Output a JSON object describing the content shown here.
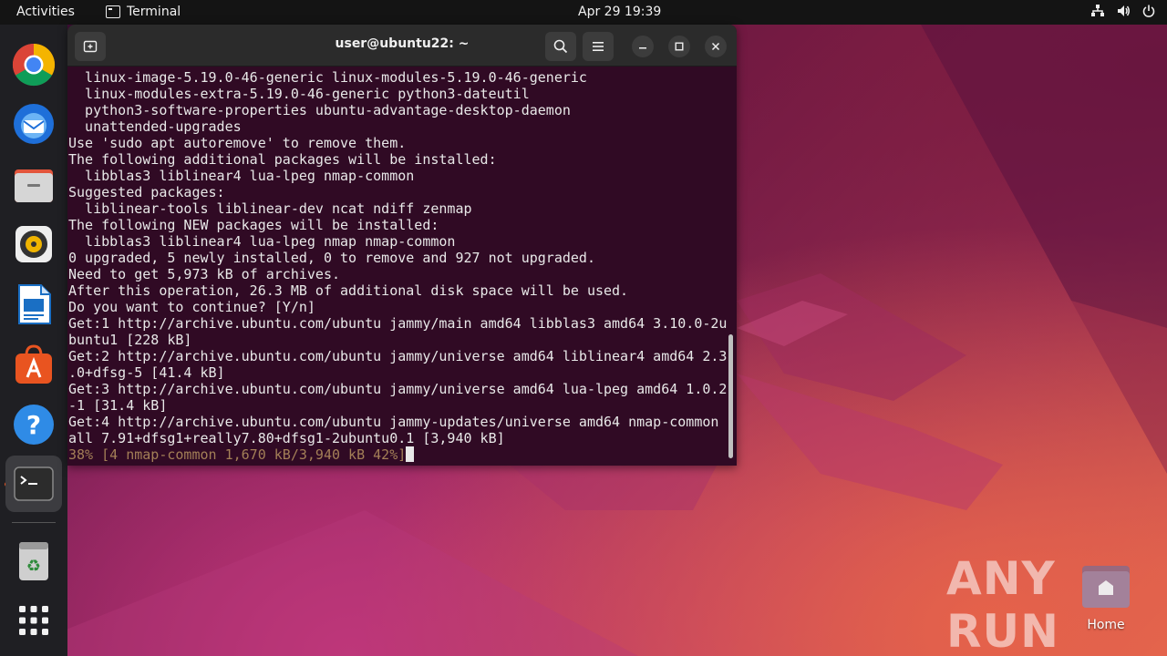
{
  "topbar": {
    "activities": "Activities",
    "app_name": "Terminal",
    "clock": "Apr 29  19:39"
  },
  "dock": {
    "items": [
      {
        "name": "chrome-icon"
      },
      {
        "name": "thunderbird-icon"
      },
      {
        "name": "files-icon"
      },
      {
        "name": "rhythmbox-icon"
      },
      {
        "name": "writer-icon"
      },
      {
        "name": "app-center-icon"
      },
      {
        "name": "help-icon"
      },
      {
        "name": "terminal-icon",
        "active": true
      },
      {
        "name": "trash-icon"
      },
      {
        "name": "show-apps-icon"
      }
    ]
  },
  "terminal": {
    "title": "user@ubuntu22: ~",
    "lines": [
      "  linux-image-5.19.0-46-generic linux-modules-5.19.0-46-generic",
      "  linux-modules-extra-5.19.0-46-generic python3-dateutil",
      "  python3-software-properties ubuntu-advantage-desktop-daemon",
      "  unattended-upgrades",
      "Use 'sudo apt autoremove' to remove them.",
      "The following additional packages will be installed:",
      "  libblas3 liblinear4 lua-lpeg nmap-common",
      "Suggested packages:",
      "  liblinear-tools liblinear-dev ncat ndiff zenmap",
      "The following NEW packages will be installed:",
      "  libblas3 liblinear4 lua-lpeg nmap nmap-common",
      "0 upgraded, 5 newly installed, 0 to remove and 927 not upgraded.",
      "Need to get 5,973 kB of archives.",
      "After this operation, 26.3 MB of additional disk space will be used.",
      "Do you want to continue? [Y/n]",
      "Get:1 http://archive.ubuntu.com/ubuntu jammy/main amd64 libblas3 amd64 3.10.0-2u",
      "buntu1 [228 kB]",
      "Get:2 http://archive.ubuntu.com/ubuntu jammy/universe amd64 liblinear4 amd64 2.3",
      ".0+dfsg-5 [41.4 kB]",
      "Get:3 http://archive.ubuntu.com/ubuntu jammy/universe amd64 lua-lpeg amd64 1.0.2",
      "-1 [31.4 kB]",
      "Get:4 http://archive.ubuntu.com/ubuntu jammy-updates/universe amd64 nmap-common ",
      "all 7.91+dfsg1+really7.80+dfsg1-2ubuntu0.1 [3,940 kB]"
    ],
    "progress_line": "38% [4 nmap-common 1,670 kB/3,940 kB 42%]",
    "colors": {
      "background": "#300a24",
      "progress": "#a37f57"
    }
  },
  "desktop": {
    "home_label": "Home",
    "watermark": "ANY RUN"
  }
}
